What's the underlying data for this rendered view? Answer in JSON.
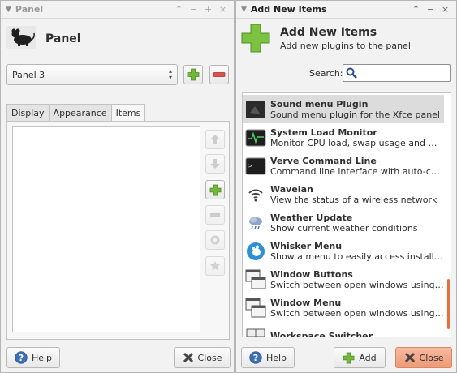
{
  "panel_window": {
    "title": "Panel",
    "controls": [
      "↑",
      "−",
      "+",
      "×"
    ],
    "header_title": "Panel",
    "combo_value": "Panel 3",
    "tabs": [
      {
        "label": "Display"
      },
      {
        "label": "Appearance"
      },
      {
        "label": "Items"
      }
    ],
    "help_label": "Help",
    "close_label": "Close"
  },
  "add_window": {
    "title": "Add New Items",
    "controls": [
      "↑",
      "−",
      "×"
    ],
    "header_title": "Add New Items",
    "header_subtitle": "Add new plugins to the panel",
    "search_label": "Search:",
    "search_value": "",
    "plugins": [
      {
        "name": "Sound menu Plugin",
        "desc": "Sound menu plugin for the Xfce panel",
        "icon": "sound-menu-icon"
      },
      {
        "name": "System Load Monitor",
        "desc": "Monitor CPU load, swap usage and mem...",
        "icon": "system-load-icon"
      },
      {
        "name": "Verve Command Line",
        "desc": "Command line interface with auto-compl...",
        "icon": "terminal-icon"
      },
      {
        "name": "Wavelan",
        "desc": "View the status of a wireless network",
        "icon": "wifi-icon"
      },
      {
        "name": "Weather Update",
        "desc": "Show current weather conditions",
        "icon": "weather-icon"
      },
      {
        "name": "Whisker Menu",
        "desc": "Show a menu to easily access installed ap...",
        "icon": "whisker-menu-icon"
      },
      {
        "name": "Window Buttons",
        "desc": "Switch between open windows using butt...",
        "icon": "window-buttons-icon"
      },
      {
        "name": "Window Menu",
        "desc": "Switch between open windows using a m...",
        "icon": "window-menu-icon"
      },
      {
        "name": "Workspace Switcher",
        "desc": "",
        "icon": "workspace-switcher-icon"
      }
    ],
    "help_label": "Help",
    "add_label": "Add",
    "close_label": "Close"
  },
  "colors": {
    "accent_close": "#f1a98a",
    "add_green": "#73b83a",
    "remove_red": "#d9534f",
    "help_blue": "#3c6fb5",
    "scrollbar": "#e96f3a"
  }
}
